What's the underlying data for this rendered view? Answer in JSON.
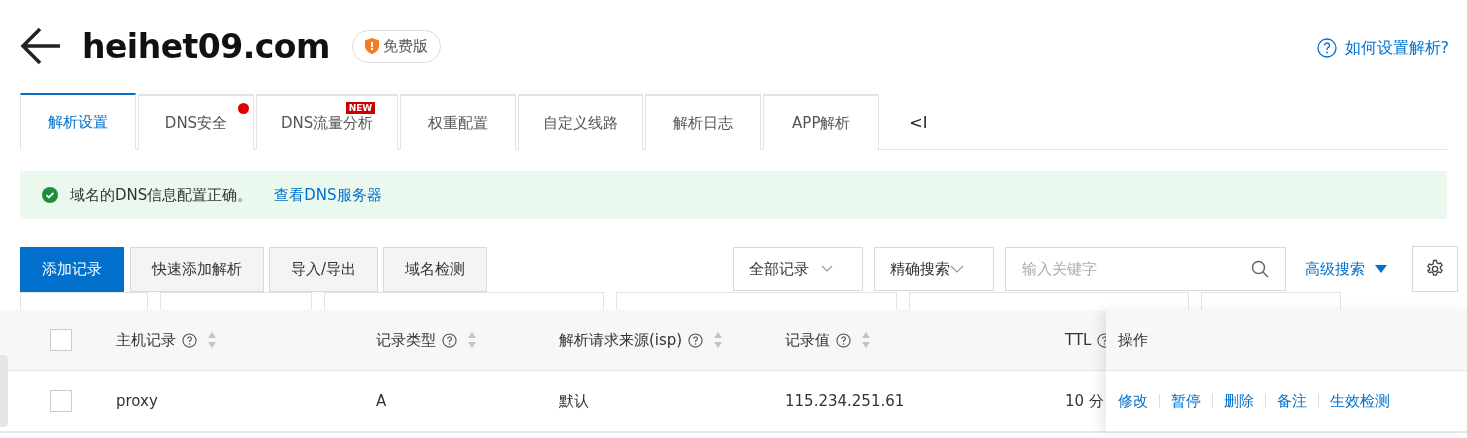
{
  "header": {
    "domain": "heihet09.com",
    "badge": "免费版",
    "help_link": "如何设置解析?"
  },
  "tabs": [
    {
      "label": "解析设置",
      "selected": true,
      "dot": false
    },
    {
      "label": "DNS安全",
      "selected": false,
      "dot": true
    },
    {
      "label": "DNS流量分析",
      "selected": false,
      "dot": false,
      "badge": "NEW"
    },
    {
      "label": "权重配置",
      "selected": false,
      "dot": false
    },
    {
      "label": "自定义线路",
      "selected": false,
      "dot": false
    },
    {
      "label": "解析日志",
      "selected": false,
      "dot": false
    },
    {
      "label": "APP解析",
      "selected": false,
      "dot": false
    }
  ],
  "tab_overflow": "<I",
  "alert": {
    "text": "域名的DNS信息配置正确。",
    "link": "查看DNS服务器"
  },
  "toolbar": {
    "buttons": [
      {
        "label": "添加记录",
        "kind": "primary"
      },
      {
        "label": "快速添加解析",
        "kind": "default"
      },
      {
        "label": "导入/导出",
        "kind": "default"
      },
      {
        "label": "域名检测",
        "kind": "default"
      }
    ],
    "record_filter": "全部记录",
    "search_mode": "精确搜索",
    "search": {
      "placeholder": "输入关键字"
    },
    "advanced_search": "高级搜索"
  },
  "table": {
    "all_checked": false,
    "columns": [
      {
        "label": "主机记录"
      },
      {
        "label": "记录类型"
      },
      {
        "label": "解析请求来源(isp)"
      },
      {
        "label": "记录值"
      },
      {
        "label": "TTL"
      }
    ],
    "actions_heading": "操作",
    "rows": [
      {
        "checked": false,
        "cells": [
          "proxy",
          "A",
          "默认",
          "115.234.251.61",
          "10 分"
        ],
        "actions": [
          "修改",
          "暂停",
          "删除",
          "备注",
          "生效检测"
        ]
      }
    ]
  }
}
